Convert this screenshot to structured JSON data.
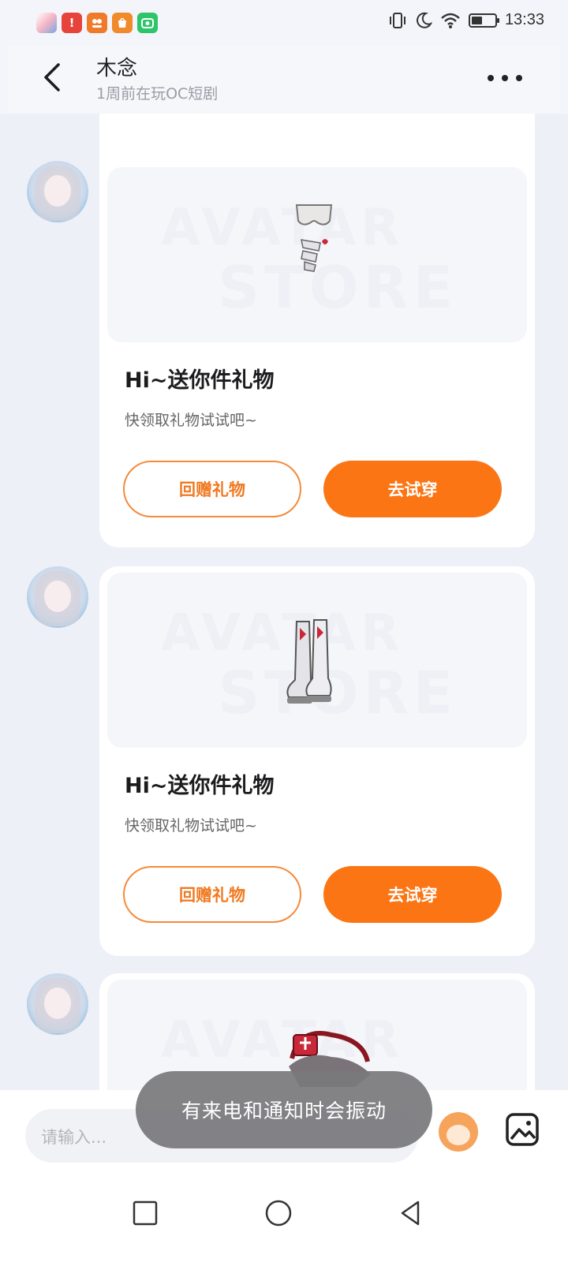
{
  "status_bar": {
    "time": "13:33",
    "battery_level_pct": 45,
    "app_icons": [
      "notification-app-icon",
      "alert-app-icon",
      "orange-app-icon",
      "shopping-app-icon",
      "camera-app-icon"
    ],
    "app_icon_glyphs": [
      "",
      "!",
      "",
      "",
      ""
    ]
  },
  "header": {
    "title": "木念",
    "subtitle": "1周前在玩OC短剧"
  },
  "messages": [
    {
      "title": "Hi~送你件礼物",
      "subtitle": "快领取礼物试试吧~",
      "btn_return": "回赠礼物",
      "btn_try": "去试穿",
      "item": "shorts-and-leg-wrap-icon"
    },
    {
      "title": "Hi~送你件礼物",
      "subtitle": "快领取礼物试试吧~",
      "btn_return": "回赠礼物",
      "btn_try": "去试穿",
      "item": "boots-icon"
    },
    {
      "item": "headwear-icon"
    }
  ],
  "watermark": {
    "line1": "AVATAR",
    "line2": "STORE"
  },
  "input": {
    "placeholder": "请输入..."
  },
  "toast": {
    "text": "有来电和通知时会振动"
  },
  "colors": {
    "accent": "#fb7514",
    "accent_outline": "#f58a3a",
    "background": "#eef0f7"
  }
}
